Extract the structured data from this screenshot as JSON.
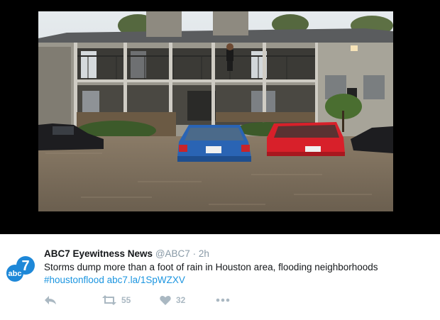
{
  "tweet": {
    "display_name": "ABC7 Eyewitness News",
    "handle": "@ABC7",
    "separator": "·",
    "time": "2h",
    "text": "Storms dump more than a foot of rain in Houston area, flooding neighborhoods",
    "hashtag": "#houstonflood",
    "link": "abc7.la/1SpWZXV",
    "avatar_text": "abc",
    "avatar_number": "7"
  },
  "actions": {
    "reply_icon": "reply-icon",
    "retweet_icon": "retweet-icon",
    "retweet_count": "55",
    "like_icon": "heart-icon",
    "like_count": "32",
    "more_icon": "more-icon"
  },
  "photo": {
    "description_icon": "flooded-apartment-photo"
  },
  "colors": {
    "name": "#14171a",
    "muted": "#8899a6",
    "link": "#1b95e0",
    "action": "#aab8c2",
    "avatar": "#1e88d8",
    "water": "#7b6e5c",
    "blue_car": "#2a64b4",
    "red_car": "#d8202a"
  }
}
